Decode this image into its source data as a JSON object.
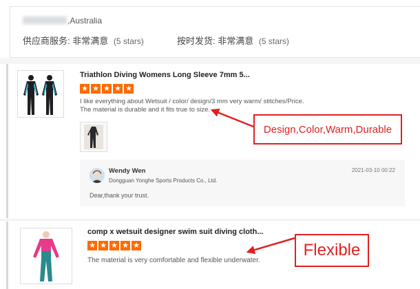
{
  "buyer": {
    "country": "Australia",
    "country_display": ",Australia"
  },
  "ratings": {
    "supplier_service_label": "供应商服务:",
    "supplier_service_value": "非常满意",
    "supplier_service_stars": "(5 stars)",
    "ontime_label": "按时发货:",
    "ontime_value": "非常满意",
    "ontime_stars": "(5 stars)"
  },
  "reviews": [
    {
      "title": "Triathlon Diving Womens Long Sleeve 7mm 5...",
      "stars": 5,
      "text_line1": "I like everything about Wetsuit / color/ design/3 mm very warm/ stitches/Price.",
      "text_line2": "The material is durable and it fits true to size.",
      "reply": {
        "name": "Wendy Wen",
        "company": "Dongguan Yonghe Sports Products Co., Ltd.",
        "date": "2021-03-10 00:22",
        "message": "Dear,thank your trust."
      },
      "annotation": "Design,Color,Warm,Durable"
    },
    {
      "title": "comp x wetsuit designer swim suit diving cloth...",
      "stars": 5,
      "text_line1": "The material is very comfortable and flexible underwater.",
      "annotation": "Flexible"
    }
  ],
  "colors": {
    "star": "#ff6a00",
    "annotation": "#e02020"
  },
  "icons": [
    "star-icon",
    "avatar-icon"
  ]
}
